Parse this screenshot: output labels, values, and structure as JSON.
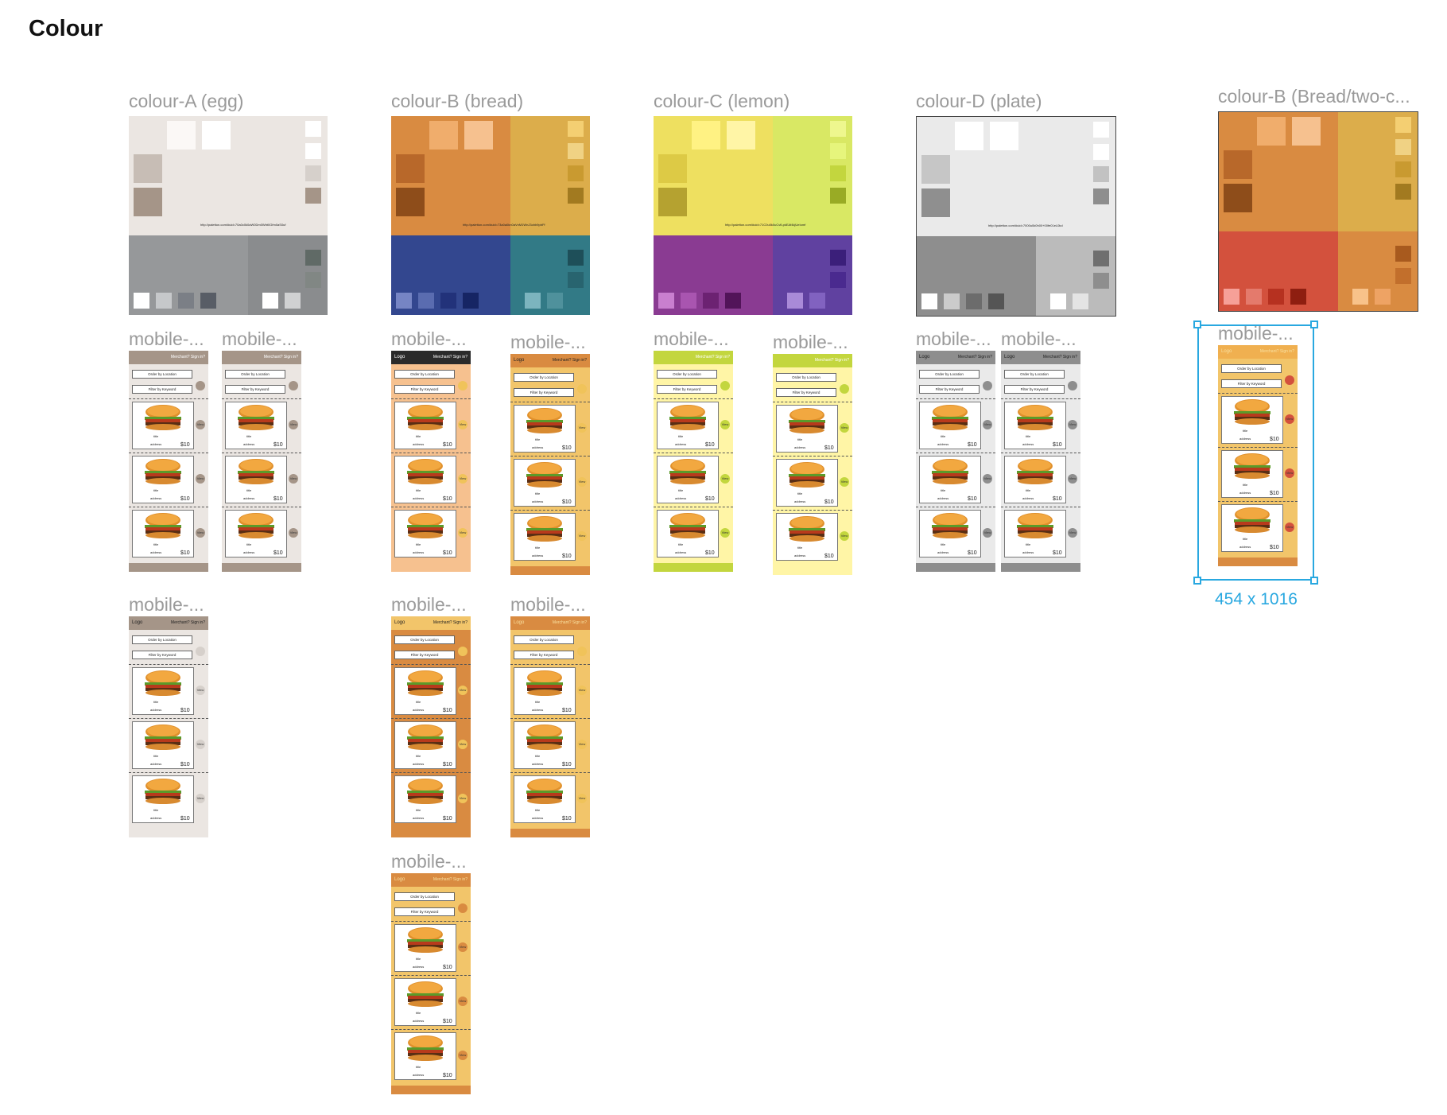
{
  "page_title": "Colour",
  "palettes": [
    {
      "label": "colour-A (egg)",
      "url": "http://paletton.com/#uid=70a0c0k0aW0Dm0Wbt0Gfm0aS0uf",
      "q": [
        "#ebe6e2",
        "#ebe6e2",
        "#96989a",
        "#8a8c8e"
      ],
      "top": [
        "#fbf8f6",
        "#ffffff"
      ],
      "left": [
        "#c7bdb5",
        "#a59588"
      ],
      "right": [
        "#ffffff",
        "#ffffff",
        "#d6d0cb",
        "#a59588"
      ],
      "bl": [
        "#ffffff",
        "#c6c8ca",
        "#7b7f86",
        "#585d66"
      ],
      "br": [
        "#ffffff",
        "#d0d1d2"
      ],
      "rr": [
        "#606a66",
        "#818784"
      ]
    },
    {
      "label": "colour-B (bread)",
      "url": "http://paletton.com/#uid=73a0a0kn0aVnM1WnJ3ohb9pbFf",
      "q": [
        "#d98b41",
        "#dcad4b",
        "#33478f",
        "#327a86"
      ],
      "top": [
        "#f0ad6c",
        "#f6c18f"
      ],
      "left": [
        "#b8682a",
        "#8e4d1a"
      ],
      "right": [
        "#f4cf72",
        "#f0d284",
        "#c99a30",
        "#a27a20"
      ],
      "bl": [
        "#7685c4",
        "#5a6cb0",
        "#22327a",
        "#162564"
      ],
      "br": [
        "#7cb4be",
        "#4f919c"
      ],
      "rr": [
        "#1e4f59",
        "#28646f"
      ]
    },
    {
      "label": "colour-C (lemon)",
      "url": "http://paletton.com/#uid=71C0u0k0uCvfLpkEAf4kjUeIomf",
      "q": [
        "#eee060",
        "#d9e864",
        "#8a3b92",
        "#6041a0"
      ],
      "top": [
        "#fff283",
        "#fff5a6"
      ],
      "left": [
        "#ddca45",
        "#b5a230"
      ],
      "right": [
        "#eef78e",
        "#e6f57c",
        "#c3d63e",
        "#99ab25"
      ],
      "bl": [
        "#c97fcf",
        "#a955b0",
        "#6c2272",
        "#521459"
      ],
      "br": [
        "#a98ad8",
        "#8162c0"
      ],
      "rr": [
        "#3b1f7a",
        "#4a2a8f"
      ]
    },
    {
      "label": "colour-D (plate)",
      "url": "http://paletton.com/#uid=7000u0k0h00+00fe01eL0kd",
      "q": [
        "#eaeaea",
        "#eaeaea",
        "#8e8e8e",
        "#bbbbbb"
      ],
      "top": [
        "#ffffff",
        "#ffffff"
      ],
      "left": [
        "#c6c6c6",
        "#8f8f8f"
      ],
      "right": [
        "#ffffff",
        "#ffffff",
        "#c2c2c2",
        "#8e8e8e"
      ],
      "bl": [
        "#ffffff",
        "#cbcbcb",
        "#6c6c6c",
        "#555555"
      ],
      "br": [
        "#ffffff",
        "#e4e4e4"
      ],
      "rr": [
        "#6f6f6f",
        "#8e8e8e"
      ]
    },
    {
      "label": "colour-B (Bread/two-c...",
      "url": "",
      "q": [
        "#d98b41",
        "#dcad4b",
        "#d3513d",
        "#d98b41"
      ],
      "top": [
        "#f0ad6c",
        "#f6c18f"
      ],
      "left": [
        "#b8682a",
        "#8e4d1a"
      ],
      "right": [
        "#f4cf72",
        "#f0d284",
        "#c99a30",
        "#a27a20"
      ],
      "bl": [
        "#f6a098",
        "#e47a6c",
        "#b63120",
        "#8e1e10"
      ],
      "br": [
        "#f8c28a",
        "#eea364"
      ],
      "rr": [
        "#a85a1e",
        "#c26f2c"
      ]
    }
  ],
  "mock_label": "mobile-...",
  "mock_text": {
    "order": "Order by Location",
    "filter": "Filter by Keyword",
    "title": "title",
    "address": "address",
    "price": "$10",
    "view": "View",
    "go": "Go",
    "logo": "Logo",
    "nav": "Merchant?  Sign in?"
  },
  "selection_dims": "454 x 1016"
}
